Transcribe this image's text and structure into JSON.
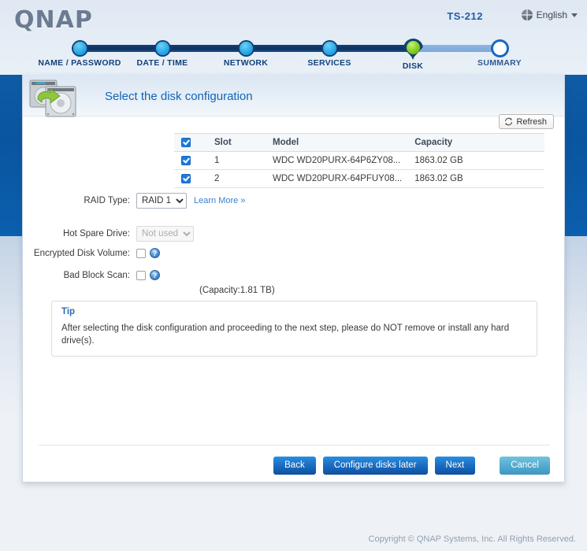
{
  "header": {
    "logo": "QNAP",
    "model": "TS-212",
    "language": "English",
    "globe_icon": "globe-icon",
    "caret_icon": "chevron-down-icon"
  },
  "wizard": {
    "steps": [
      {
        "label": "NAME / PASSWORD",
        "state": "completed"
      },
      {
        "label": "DATE / TIME",
        "state": "completed"
      },
      {
        "label": "NETWORK",
        "state": "completed"
      },
      {
        "label": "SERVICES",
        "state": "completed"
      },
      {
        "label": "DISK",
        "state": "current"
      },
      {
        "label": "SUMMARY",
        "state": "upcoming"
      }
    ]
  },
  "panel": {
    "title": "Select the disk configuration",
    "icon": "hard-disk-configuration-icon",
    "refresh": {
      "label": "Refresh",
      "icon": "refresh-icon"
    }
  },
  "disk_table": {
    "columns": [
      "",
      "Slot",
      "Model",
      "Capacity"
    ],
    "header_checkbox_checked": true,
    "rows": [
      {
        "checked": true,
        "slot": "1",
        "model": "WDC WD20PURX-64P6ZY08...",
        "capacity": "1863.02 GB"
      },
      {
        "checked": true,
        "slot": "2",
        "model": "WDC WD20PURX-64PFUY08...",
        "capacity": "1863.02 GB"
      }
    ]
  },
  "form": {
    "raid_type": {
      "label": "RAID Type:",
      "value": "RAID 1",
      "options": [
        "RAID 1"
      ],
      "learn_more": "Learn More »"
    },
    "capacity_note": "(Capacity:1.81 TB)",
    "hot_spare": {
      "label": "Hot Spare Drive:",
      "value": "Not used",
      "options": [
        "Not used"
      ],
      "disabled": true
    },
    "encrypted_volume": {
      "label": "Encrypted Disk Volume:",
      "checked": false,
      "help": "?"
    },
    "bad_block_scan": {
      "label": "Bad Block Scan:",
      "checked": false,
      "help": "?"
    }
  },
  "tip": {
    "title": "Tip",
    "text": "After selecting the disk configuration and proceeding to the next step, please do NOT remove or install any hard drive(s)."
  },
  "buttons": {
    "back": "Back",
    "configure_later": "Configure disks later",
    "next": "Next",
    "cancel": "Cancel"
  },
  "footer": {
    "copyright": "Copyright © QNAP Systems, Inc. All Rights Reserved."
  },
  "colors": {
    "accent_blue": "#1464b4",
    "track_done": "#123f78",
    "track_todo": "#8fb4e0",
    "current_step_green": "#8ed329",
    "checkbox_blue": "#1e7ae0",
    "side_band": "#0a559f"
  }
}
